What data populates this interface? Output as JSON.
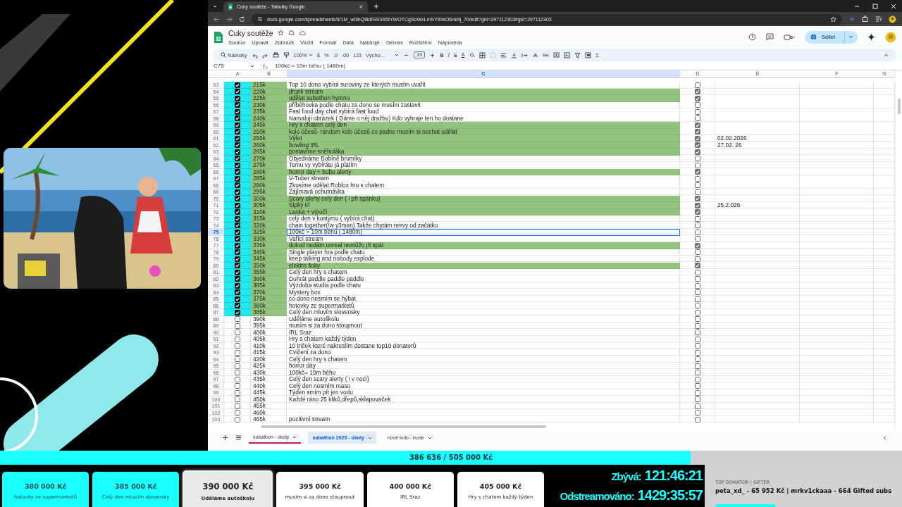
{
  "browser": {
    "tab": {
      "title": "Cuky soutěže - Tabulky Google"
    },
    "url": "docs.google.com/spreadsheets/d/1M_w0ihQl8dfGS0A5tYWOTCgSoWxLmSY99sO6nk9j_70/edit?gid=297112303#gid=297112303"
  },
  "sheet": {
    "title": "Cuky soutěže",
    "menus": [
      "Soubor",
      "Upravit",
      "Zobrazit",
      "Vložit",
      "Formát",
      "Data",
      "Nástroje",
      "Gemini",
      "Rozšíření",
      "Nápověda"
    ],
    "share": "Sdílet",
    "toolbar": {
      "search": "Nabídky",
      "zoom": "100%",
      "currency": "$",
      "percent": "%",
      "decimals_less": ".0",
      "decimals_more": ".00",
      "number_format": "123",
      "font": "Výcho...",
      "font_size": "10",
      "bold": "B",
      "italic": "I",
      "strike": "S",
      "text_color": "A",
      "sum": "Σ"
    },
    "name_box": "C75",
    "formula": "100kč = 10m běhu ( 1480m)",
    "columns": [
      {
        "label": "A",
        "selected": false
      },
      {
        "label": "B",
        "selected": false
      },
      {
        "label": "C",
        "selected": true
      },
      {
        "label": "D",
        "selected": false
      },
      {
        "label": "E",
        "selected": false
      },
      {
        "label": "F",
        "selected": false
      },
      {
        "label": "G",
        "selected": false
      }
    ],
    "rows": [
      {
        "number": "53",
        "a_checked": true,
        "b": "215k",
        "c": "Top 10 dono vybírá suroviny ze kterých musím uvařit",
        "highlighted": false,
        "d_checked": false,
        "selected": false
      },
      {
        "number": "54",
        "a_checked": true,
        "b": "220k",
        "c": "drunk stream",
        "highlighted": true,
        "d_checked": true,
        "selected": false
      },
      {
        "number": "55",
        "a_checked": true,
        "b": "225k",
        "c": "udělat subathon hymnu",
        "highlighted": true,
        "d_checked": true,
        "selected": false
      },
      {
        "number": "56",
        "a_checked": true,
        "b": "230k",
        "c": "příběhovka podle chatu za dono se musím zastavit",
        "highlighted": false,
        "d_checked": false,
        "selected": false
      },
      {
        "number": "57",
        "a_checked": true,
        "b": "235k",
        "c": "Fast food day chat vybírá fast food",
        "highlighted": false,
        "d_checked": false,
        "selected": false
      },
      {
        "number": "58",
        "a_checked": true,
        "b": "240k",
        "c": "Namaluji obrázek ( Dáme o něj dražbu) Kdo vyhraje ten ho dostane",
        "highlighted": false,
        "d_checked": false,
        "selected": false
      },
      {
        "number": "59",
        "a_checked": true,
        "b": "245k",
        "c": "Hry s chatem celý den",
        "highlighted": true,
        "d_checked": true,
        "selected": false
      },
      {
        "number": "60",
        "a_checked": true,
        "b": "250k",
        "c": "kolo účesů- random kolo účesů co padne musím si nechat udělat",
        "highlighted": true,
        "d_checked": true,
        "selected": false
      },
      {
        "number": "61",
        "a_checked": true,
        "b": "255k",
        "c": "Výlet",
        "highlighted": true,
        "d_checked": true,
        "e": "02.02.2026",
        "selected": false
      },
      {
        "number": "62",
        "a_checked": true,
        "b": "260k",
        "c": "bowling IRL",
        "highlighted": true,
        "d_checked": true,
        "e": "27.02. 26",
        "selected": false
      },
      {
        "number": "63",
        "a_checked": true,
        "b": "265k",
        "c": "postavíme sněhuláka",
        "highlighted": true,
        "d_checked": true,
        "selected": false
      },
      {
        "number": "64",
        "a_checked": true,
        "b": "270k",
        "c": "Objednáme Bobíně brumíky",
        "highlighted": false,
        "d_checked": false,
        "selected": false
      },
      {
        "number": "65",
        "a_checked": true,
        "b": "275k",
        "c": "Temu vy vybíráte já platím",
        "highlighted": false,
        "d_checked": false,
        "selected": false
      },
      {
        "number": "66",
        "a_checked": true,
        "b": "280k",
        "c": "horror day + bubu alerty",
        "highlighted": true,
        "d_checked": true,
        "selected": false
      },
      {
        "number": "67",
        "a_checked": true,
        "b": "285k",
        "c": "V-Tuber stream",
        "highlighted": false,
        "d_checked": false,
        "selected": false
      },
      {
        "number": "68",
        "a_checked": true,
        "b": "290k",
        "c": "Zkusíme udělat Roblox hru s chatem",
        "highlighted": false,
        "d_checked": false,
        "selected": false
      },
      {
        "number": "69",
        "a_checked": true,
        "b": "295k",
        "c": "Zajímavá ochutnávka",
        "highlighted": false,
        "d_checked": false,
        "selected": false
      },
      {
        "number": "70",
        "a_checked": true,
        "b": "300k",
        "c": "Scary alerty celý den ( i při spánku)",
        "highlighted": true,
        "d_checked": true,
        "selected": false
      },
      {
        "number": "71",
        "a_checked": true,
        "b": "305k",
        "c": "Šipky irl",
        "highlighted": true,
        "d_checked": true,
        "e": "25.2.026",
        "selected": false
      },
      {
        "number": "72",
        "a_checked": true,
        "b": "310k",
        "c": "Lanka + výročí",
        "highlighted": true,
        "d_checked": true,
        "selected": false
      },
      {
        "number": "73",
        "a_checked": true,
        "b": "315k",
        "c": "celý den v kostýmu ( vybírá chat)",
        "highlighted": false,
        "d_checked": false,
        "selected": false
      },
      {
        "number": "74",
        "a_checked": true,
        "b": "320k",
        "c": "chain together(/w y3man) Takže chytám nervy od začátku",
        "highlighted": false,
        "d_checked": false,
        "selected": false
      },
      {
        "number": "75",
        "a_checked": true,
        "b": "325k",
        "c": "100kč = 10m běhu ( 1480m)",
        "highlighted": false,
        "d_checked": false,
        "selected": true
      },
      {
        "number": "76",
        "a_checked": true,
        "b": "330k",
        "c": "Vařící stream",
        "highlighted": false,
        "d_checked": false,
        "selected": false
      },
      {
        "number": "77",
        "a_checked": true,
        "b": "335k",
        "c": "dokud nedám unreal nemůžu jít spát",
        "highlighted": true,
        "d_checked": true,
        "selected": false
      },
      {
        "number": "78",
        "a_checked": true,
        "b": "340k",
        "c": "Single player hra podle chatu",
        "highlighted": false,
        "d_checked": false,
        "selected": false
      },
      {
        "number": "79",
        "a_checked": true,
        "b": "345k",
        "c": "keep talking and nobody explode",
        "highlighted": false,
        "d_checked": false,
        "selected": false
      },
      {
        "number": "80",
        "a_checked": true,
        "b": "350k",
        "c": "elektro šoky",
        "highlighted": true,
        "d_checked": true,
        "selected": false
      },
      {
        "number": "81",
        "a_checked": true,
        "b": "355k",
        "c": "Celý den hry s chatem",
        "highlighted": false,
        "d_checked": false,
        "selected": false
      },
      {
        "number": "82",
        "a_checked": true,
        "b": "360k",
        "c": "Dohrát paddle paddle paddle",
        "highlighted": false,
        "d_checked": false,
        "selected": false
      },
      {
        "number": "83",
        "a_checked": true,
        "b": "365k",
        "c": "Výzdoba studia podle chatu",
        "highlighted": false,
        "d_checked": false,
        "selected": false
      },
      {
        "number": "84",
        "a_checked": true,
        "b": "370k",
        "c": "Mystery box",
        "highlighted": false,
        "d_checked": false,
        "selected": false
      },
      {
        "number": "85",
        "a_checked": true,
        "b": "375k",
        "c": "co dono nesmím se hýbat",
        "highlighted": false,
        "d_checked": false,
        "selected": false
      },
      {
        "number": "86",
        "a_checked": true,
        "b": "380k",
        "c": "hotovky ze supermarketů",
        "highlighted": false,
        "d_checked": false,
        "selected": false
      },
      {
        "number": "87",
        "a_checked": true,
        "b": "385k",
        "c": "Celý den mluvím slovensky",
        "highlighted": false,
        "d_checked": false,
        "selected": false
      },
      {
        "number": "88",
        "a_checked": false,
        "b": "390k",
        "c": "Uděláme autoškolu",
        "highlighted": false,
        "d_checked": false,
        "selected": false
      },
      {
        "number": "89",
        "a_checked": false,
        "b": "395k",
        "c": "musím si za dono stoupnout",
        "highlighted": false,
        "d_checked": false,
        "selected": false
      },
      {
        "number": "90",
        "a_checked": false,
        "b": "400k",
        "c": "IRL Sraz",
        "highlighted": false,
        "d_checked": false,
        "selected": false
      },
      {
        "number": "91",
        "a_checked": false,
        "b": "405k",
        "c": "Hry s chatem každý týden",
        "highlighted": false,
        "d_checked": false,
        "selected": false
      },
      {
        "number": "92",
        "a_checked": false,
        "b": "410k",
        "c": "10 triček které nakreslím dostane top10 donatorů",
        "highlighted": false,
        "d_checked": false,
        "selected": false
      },
      {
        "number": "93",
        "a_checked": false,
        "b": "415k",
        "c": "Cvičení za dono",
        "highlighted": false,
        "d_checked": false,
        "selected": false
      },
      {
        "number": "94",
        "a_checked": false,
        "b": "420k",
        "c": "Celý den hry s chatem",
        "highlighted": false,
        "d_checked": false,
        "selected": false
      },
      {
        "number": "95",
        "a_checked": false,
        "b": "425k",
        "c": "horror day",
        "highlighted": false,
        "d_checked": false,
        "selected": false
      },
      {
        "number": "96",
        "a_checked": false,
        "b": "430k",
        "c": "100kč= 10m běhu",
        "highlighted": false,
        "d_checked": false,
        "selected": false
      },
      {
        "number": "97",
        "a_checked": false,
        "b": "435k",
        "c": "Celý den scary alerty ( i v noci)",
        "highlighted": false,
        "d_checked": false,
        "selected": false
      },
      {
        "number": "98",
        "a_checked": false,
        "b": "440k",
        "c": "Celý den nesmím maso",
        "highlighted": false,
        "d_checked": false,
        "selected": false
      },
      {
        "number": "99",
        "a_checked": false,
        "b": "445k",
        "c": "Týden smím pít jen vodu",
        "highlighted": false,
        "d_checked": false,
        "selected": false
      },
      {
        "number": "100",
        "a_checked": false,
        "b": "450k",
        "c": "Každé ráno 25 kliků,dřepů,sklapovaček",
        "highlighted": false,
        "d_checked": false,
        "selected": false
      },
      {
        "number": "101",
        "a_checked": false,
        "b": "455k",
        "highlighted": false,
        "d_checked": false,
        "selected": false
      },
      {
        "number": "102",
        "a_checked": false,
        "b": "460k",
        "highlighted": false,
        "d_checked": false,
        "selected": false
      },
      {
        "number": "103",
        "a_checked": false,
        "b": "465k",
        "c": "pozitivní stream",
        "highlighted": false,
        "d_checked": false,
        "selected": false
      }
    ],
    "tabs": [
      {
        "label": "subathon - úkoly",
        "selected": false,
        "color": "#c2185b"
      },
      {
        "label": "subathon 2025 - úkoly",
        "selected": true
      },
      {
        "label": "nové kolo - bude",
        "selected": false
      }
    ]
  },
  "overlay": {
    "progress": {
      "text": "386 636 / 505 000 Kč",
      "level": 0.7656
    },
    "goals": [
      {
        "amount": "380 000 Kč",
        "label": "hotovky ze supermarketů",
        "kind": "done"
      },
      {
        "amount": "385 000 Kč",
        "label": "Celý den mluvím slovensky",
        "kind": "done"
      },
      {
        "amount": "390 000 Kč",
        "label": "Uděláme autoškolu",
        "kind": "current"
      },
      {
        "amount": "395 000 Kč",
        "label": "musím si za dono stoupnout",
        "kind": "next"
      },
      {
        "amount": "400 000 Kč",
        "label": "IRL Sraz",
        "kind": "next"
      },
      {
        "amount": "405 000 Kč",
        "label": "Hry s chatem každý týden",
        "kind": "next"
      }
    ],
    "timers": [
      {
        "label": "Zbývá:",
        "value": "121:46:21"
      },
      {
        "label": "Odstreamováno:",
        "value": "1429:35:57"
      }
    ],
    "top_donator": {
      "title": "TOP DONATOR | GIFTER",
      "text": "peta_xd_ - 65 952 Kč | mrkv1ckaaa - 664 Gifted subs"
    }
  }
}
